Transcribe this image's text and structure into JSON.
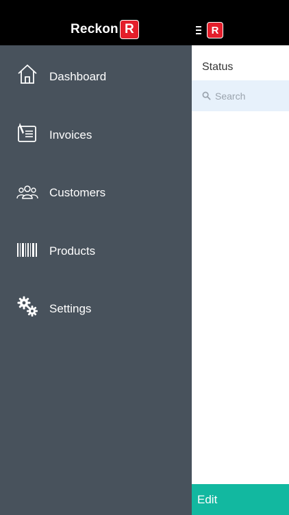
{
  "brand": {
    "name": "Reckon",
    "badge_letter": "R",
    "badge_color": "#e41e2b"
  },
  "drawer": {
    "background": "#48525c",
    "items": [
      {
        "label": "Dashboard",
        "icon": "house-icon"
      },
      {
        "label": "Invoices",
        "icon": "invoice-icon"
      },
      {
        "label": "Customers",
        "icon": "customers-icon"
      },
      {
        "label": "Products",
        "icon": "barcode-icon"
      },
      {
        "label": "Settings",
        "icon": "gears-icon"
      }
    ]
  },
  "main": {
    "header_badge_letter": "R",
    "title": "Status",
    "search": {
      "placeholder": "Search",
      "value": ""
    },
    "footer": {
      "edit_label": "Edit",
      "color": "#12b8a0"
    }
  }
}
